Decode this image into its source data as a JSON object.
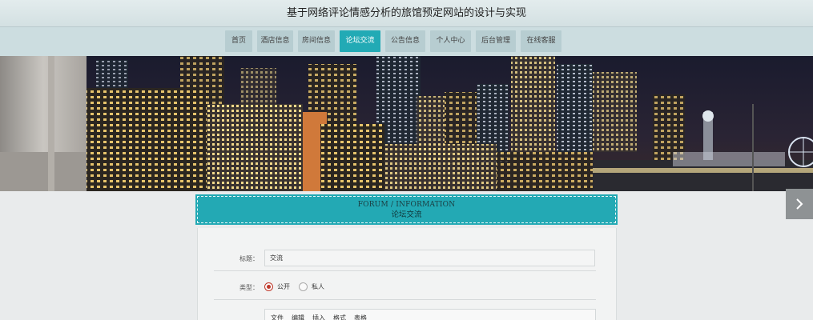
{
  "header": {
    "title": "基于网络评论情感分析的旅馆预定网站的设计与实现"
  },
  "nav": {
    "items": [
      {
        "label": "首页",
        "active": false
      },
      {
        "label": "酒店信息",
        "active": false
      },
      {
        "label": "房间信息",
        "active": false
      },
      {
        "label": "论坛交流",
        "active": true
      },
      {
        "label": "公告信息",
        "active": false
      },
      {
        "label": "个人中心",
        "active": false
      },
      {
        "label": "后台管理",
        "active": false
      },
      {
        "label": "在线客服",
        "active": false
      }
    ]
  },
  "banner": {
    "next_icon": "chevron-right-icon"
  },
  "section": {
    "title_en": "FORUM / INFORMATION",
    "title_cn": "论坛交流"
  },
  "form": {
    "title_label": "标题：",
    "title_value": "交流",
    "type_label": "类型：",
    "type_options": [
      {
        "label": "公开",
        "checked": true
      },
      {
        "label": "私人",
        "checked": false
      }
    ],
    "editor_menu": [
      "文件",
      "编辑",
      "插入",
      "格式",
      "表格"
    ]
  },
  "colors": {
    "accent": "#23a9b4",
    "nav_bg": "#ccdde0",
    "radio_on": "#c0392b"
  }
}
